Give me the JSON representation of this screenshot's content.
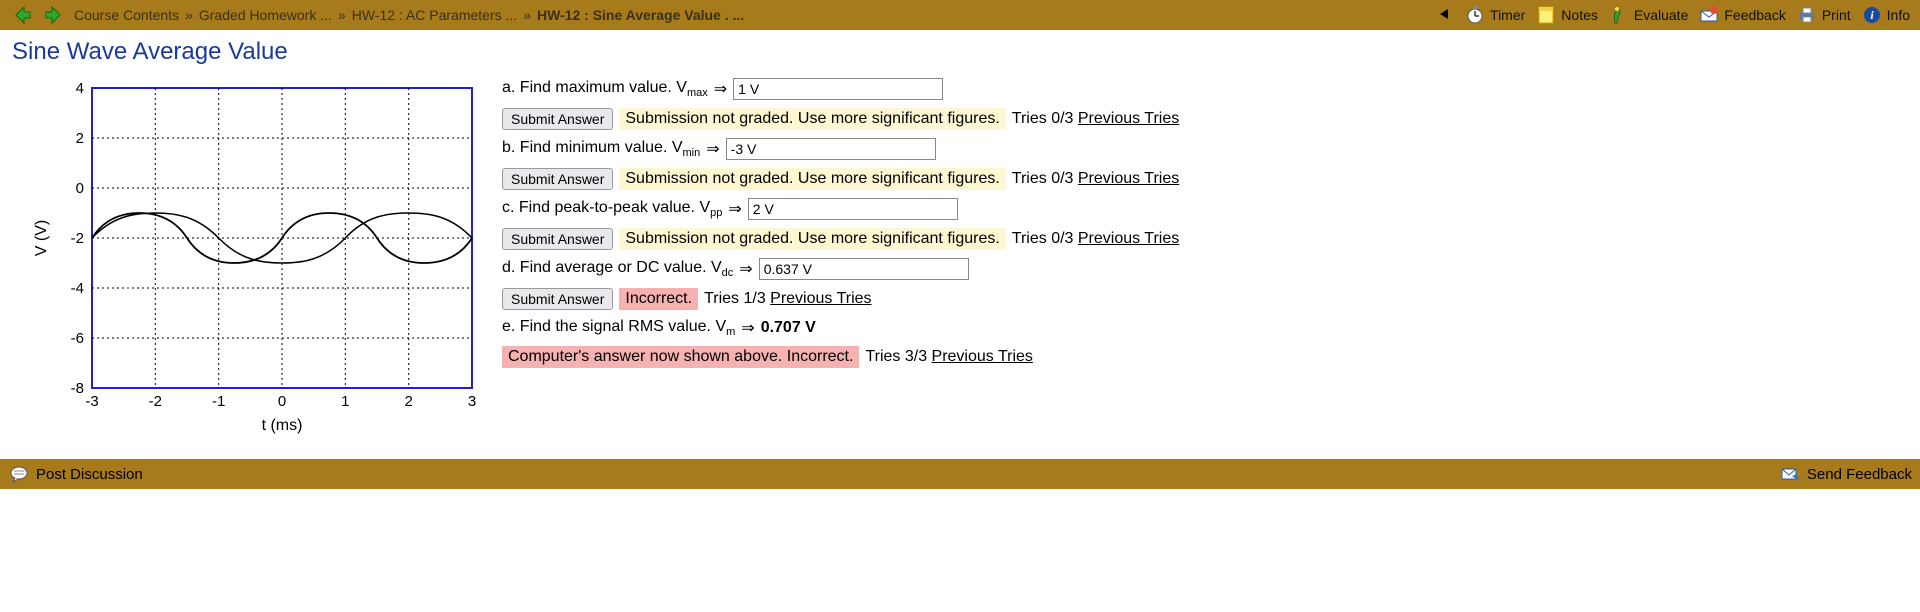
{
  "toolbar": {
    "breadcrumb": {
      "items": [
        "Course Contents",
        "Graded Homework ...",
        "HW-12 : AC Parameters ..."
      ],
      "last": "HW-12 : Sine Average Value . ..."
    },
    "timer": "Timer",
    "notes": "Notes",
    "evaluate": "Evaluate",
    "feedback": "Feedback",
    "print": "Print",
    "info": "Info"
  },
  "page_title": "Sine Wave Average Value",
  "questions": {
    "a": {
      "prompt": "a. Find maximum value. V",
      "sub": "max",
      "value": "1 V"
    },
    "b": {
      "prompt": "b. Find minimum value. V",
      "sub": "min",
      "value": "-3 V"
    },
    "c": {
      "prompt": "c. Find peak-to-peak value. V",
      "sub": "pp",
      "value": "2 V"
    },
    "d": {
      "prompt": "d. Find average or DC value. V",
      "sub": "dc",
      "value": "0.637 V"
    },
    "e": {
      "prompt": "e. Find the signal RMS value. V",
      "sub": "m",
      "bold_value": "0.707 V"
    }
  },
  "feedback": {
    "submit_label": "Submit Answer",
    "not_graded": "Submission not graded. Use more significant figures.",
    "tries_0_3": "Tries 0/3 ",
    "incorrect": "Incorrect.",
    "tries_1_3": "Tries 1/3 ",
    "computer_shown": "Computer's answer now shown above. Incorrect.",
    "tries_3_3": "Tries 3/3 ",
    "previous_tries": "Previous Tries"
  },
  "graph": {
    "xlabel": "t (ms)",
    "ylabel": "V (V)",
    "xticks": [
      "-3",
      "-2",
      "-1",
      "0",
      "1",
      "2",
      "3"
    ],
    "yticks": [
      "4",
      "2",
      "0",
      "-2",
      "-4",
      "-6",
      "-8"
    ]
  },
  "footer": {
    "post_discussion": "Post Discussion",
    "send_feedback": "Send Feedback"
  },
  "chart_data": {
    "type": "line",
    "title": "",
    "xlabel": "t (ms)",
    "ylabel": "V (V)",
    "xlim": [
      -3,
      3
    ],
    "ylim": [
      -8,
      4
    ],
    "dc_offset": -2,
    "amplitude": 1,
    "period_ms": 3,
    "phase_at_x0": "descending through dc offset",
    "series": [
      {
        "name": "V",
        "formula": "-2 + 1*sin(-2*pi*t/3)",
        "sample_x": [
          -3,
          -2.5,
          -2,
          -1.5,
          -1,
          -0.5,
          0,
          0.5,
          1,
          1.5,
          2,
          2.5,
          3
        ],
        "sample_y": [
          -2,
          -1.13,
          -1.13,
          -2,
          -2.87,
          -2.87,
          -2,
          -1.13,
          -1.13,
          -2,
          -2.87,
          -2.87,
          -2
        ]
      }
    ]
  }
}
